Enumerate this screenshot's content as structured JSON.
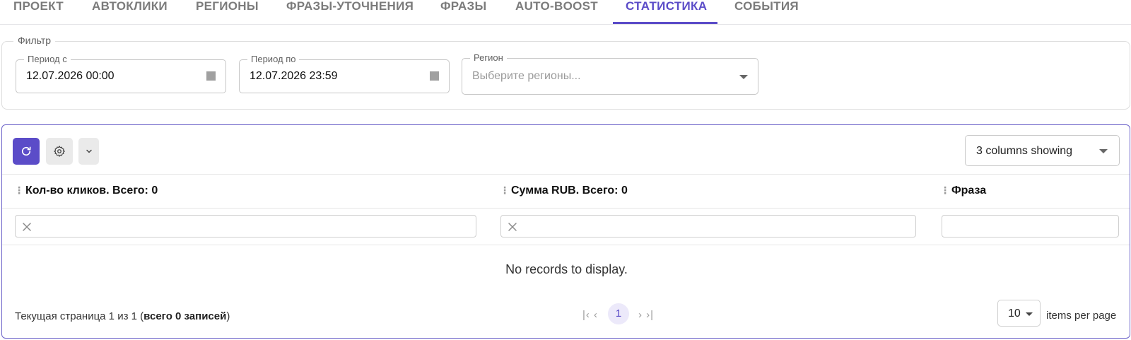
{
  "tabs": [
    {
      "label": "Проект"
    },
    {
      "label": "Автоклики"
    },
    {
      "label": "Регионы"
    },
    {
      "label": "Фразы-уточнения"
    },
    {
      "label": "Фразы"
    },
    {
      "label": "Auto-Boost"
    },
    {
      "label": "Статистика"
    },
    {
      "label": "События"
    }
  ],
  "active_tab": "Статистика",
  "filter": {
    "legend": "Фильтр",
    "period_from": {
      "label": "Период с",
      "value": "12.07.2026 00:00"
    },
    "period_to": {
      "label": "Период по",
      "value": "12.07.2026 23:59"
    },
    "region": {
      "label": "Регион",
      "placeholder": "Выберите регионы..."
    }
  },
  "toolbar": {
    "refresh_icon": "refresh-icon",
    "settings_icon": "gear-icon",
    "more_icon": "chevron-down-icon",
    "columns_select": "3 columns showing"
  },
  "table": {
    "columns": [
      {
        "header": "Кол-во кликов. Всего: 0"
      },
      {
        "header": "Сумма RUB. Всего: 0"
      },
      {
        "header": "Фраза"
      }
    ],
    "empty_message": "No records to display."
  },
  "footer": {
    "page_info_prefix": "Текущая страница 1 из 1 (",
    "page_info_bold": "всего 0 записей",
    "page_info_suffix": ")",
    "first": "|‹ ‹",
    "last": "› ›|",
    "current_page": "1",
    "per_page": "10",
    "per_page_label": "items per page"
  },
  "colors": {
    "accent": "#5b4cc8",
    "panel_border": "#6c63c9"
  }
}
